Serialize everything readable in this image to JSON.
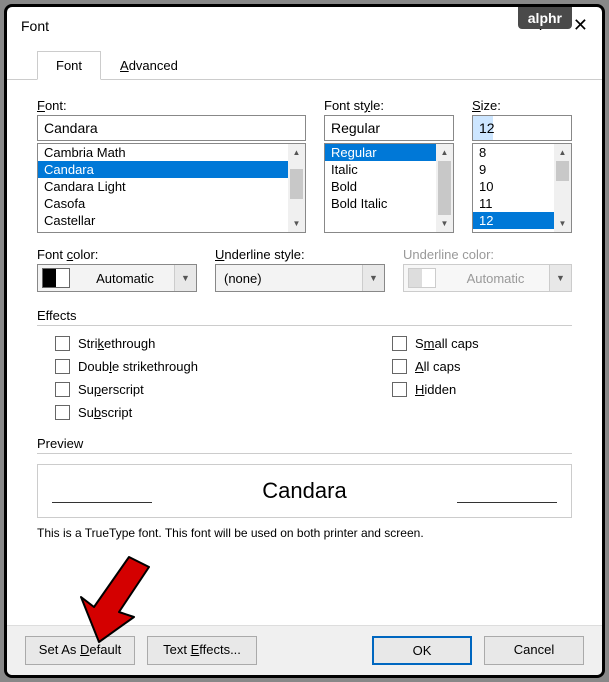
{
  "brand": "alphr",
  "title": "Font",
  "tabs": {
    "font": "Font",
    "advanced": "Advanced"
  },
  "labels": {
    "font": "Font:",
    "style": "Font style:",
    "size": "Size:",
    "fontcolor": "Font color:",
    "underlinestyle": "Underline style:",
    "underlinecolor": "Underline color:",
    "effects": "Effects",
    "preview": "Preview"
  },
  "fontInput": "Candara",
  "fontList": [
    "Cambria Math",
    "Candara",
    "Candara Light",
    "Casofa",
    "Castellar"
  ],
  "fontSelected": "Candara",
  "styleInput": "Regular",
  "styleList": [
    "Regular",
    "Italic",
    "Bold",
    "Bold Italic"
  ],
  "styleSelected": "Regular",
  "sizeInput": "12",
  "sizeList": [
    "8",
    "9",
    "10",
    "11",
    "12"
  ],
  "sizeSelected": "12",
  "combos": {
    "fontcolor": "Automatic",
    "underlinestyle": "(none)",
    "underlinecolor": "Automatic"
  },
  "effects": {
    "strike": "Strikethrough",
    "dstrike": "Double strikethrough",
    "super": "Superscript",
    "sub": "Subscript",
    "smallcaps": "Small caps",
    "allcaps": "All caps",
    "hidden": "Hidden"
  },
  "previewFont": "Candara",
  "note": "This is a TrueType font. This font will be used on both printer and screen.",
  "buttons": {
    "default": "Set As Default",
    "effects": "Text Effects...",
    "ok": "OK",
    "cancel": "Cancel"
  }
}
